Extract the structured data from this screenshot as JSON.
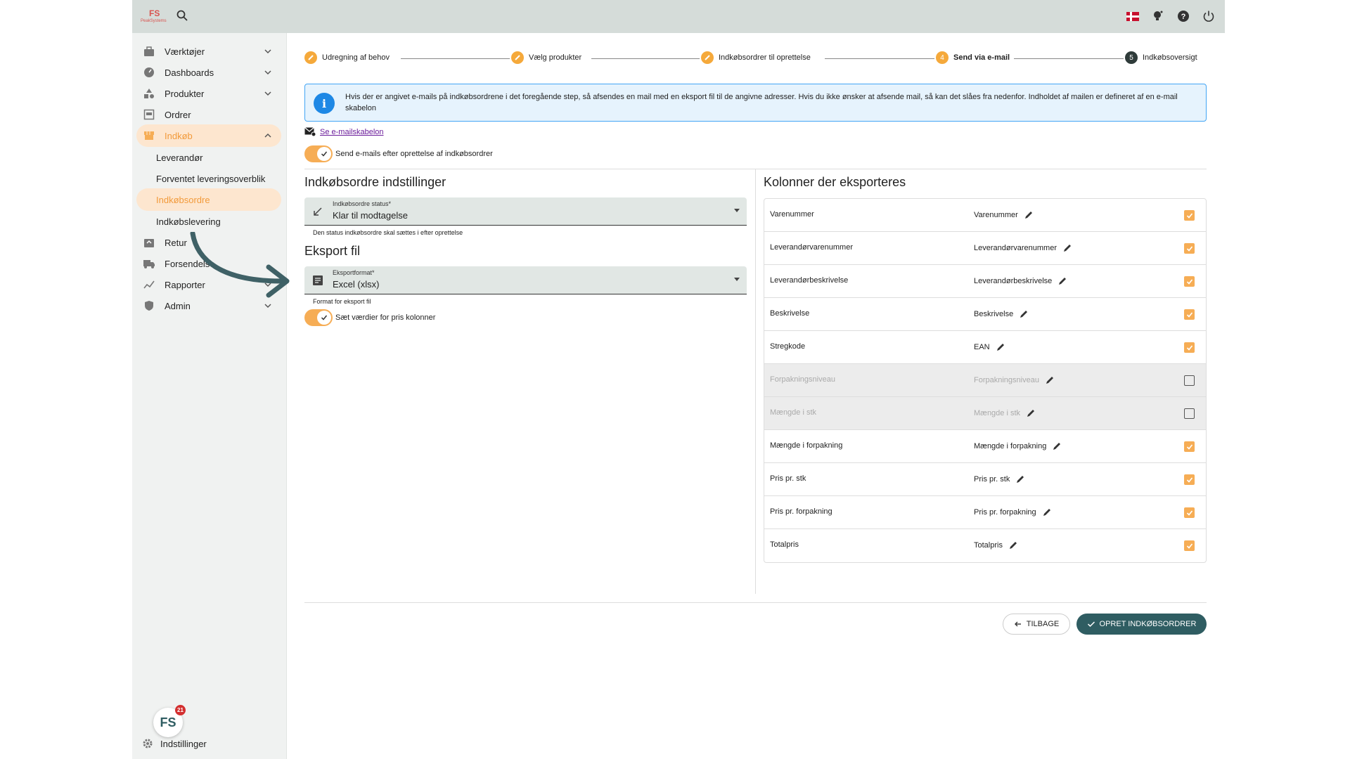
{
  "topbar": {
    "logo_mark": "FS",
    "logo_name": "PeakSystems",
    "icons": [
      "search-icon",
      "danish-flag-icon",
      "lightbulb-icon",
      "help-icon",
      "power-icon"
    ]
  },
  "sidebar": {
    "items": [
      {
        "label": "Værktøjer",
        "icon": "tools-icon",
        "expandable": true
      },
      {
        "label": "Dashboards",
        "icon": "dashboard-icon",
        "expandable": true
      },
      {
        "label": "Produkter",
        "icon": "products-icon",
        "expandable": true
      },
      {
        "label": "Ordrer",
        "icon": "orders-icon",
        "expandable": false
      },
      {
        "label": "Indkøb",
        "icon": "purchase-icon",
        "expandable": true,
        "expanded": true
      }
    ],
    "subitems": [
      {
        "label": "Leverandør"
      },
      {
        "label": "Forventet leveringsoverblik"
      },
      {
        "label": "Indkøbsordre"
      },
      {
        "label": "Indkøbslevering"
      }
    ],
    "items_after": [
      {
        "label": "Retur",
        "icon": "return-icon",
        "expandable": false
      },
      {
        "label": "Forsendelse",
        "icon": "shipping-icon",
        "expandable": false
      },
      {
        "label": "Rapporter",
        "icon": "reports-icon",
        "expandable": true
      },
      {
        "label": "Admin",
        "icon": "admin-icon",
        "expandable": true
      }
    ],
    "settings_label": "Indstillinger",
    "badge_logo": "FS",
    "badge_count": "21"
  },
  "stepper": {
    "steps": [
      {
        "label": "Udregning af behov",
        "state": "done"
      },
      {
        "label": "Vælg produkter",
        "state": "done"
      },
      {
        "label": "Indkøbsordrer til oprettelse",
        "state": "done"
      },
      {
        "label": "Send via e-mail",
        "state": "active",
        "number": "4"
      },
      {
        "label": "Indkøbsoversigt",
        "state": "pending",
        "number": "5"
      }
    ]
  },
  "info": {
    "text": "Hvis der er angivet e-mails på indkøbsordrene i det foregående step, så afsendes en mail med en eksport fil til de angivne adresser. Hvis du ikke ønsker at afsende mail, så kan det slåes fra nedenfor. Indholdet af mailen er defineret af en e-mail skabelon"
  },
  "email": {
    "template_link": "Se e-mailskabelon",
    "send_toggle_label": "Send e-mails efter oprettelse af indkøbsordrer",
    "send_toggle_on": true
  },
  "settings": {
    "title": "Indkøbsordre indstillinger",
    "status_label": "Indkøbsordre status*",
    "status_value": "Klar til modtagelse",
    "status_helper": "Den status indkøbsordre skal sættes i efter oprettelse",
    "export_title": "Eksport fil",
    "format_label": "Eksportformat*",
    "format_value": "Excel (xlsx)",
    "format_helper": "Format for eksport fil",
    "price_toggle_label": "Sæt værdier for pris kolonner",
    "price_toggle_on": true
  },
  "columns": {
    "title": "Kolonner der eksporteres",
    "rows": [
      {
        "name": "Varenummer",
        "alias": "Varenummer",
        "checked": true
      },
      {
        "name": "Leverandørvarenummer",
        "alias": "Leverandørvarenummer",
        "checked": true
      },
      {
        "name": "Leverandørbeskrivelse",
        "alias": "Leverandørbeskrivelse",
        "checked": true
      },
      {
        "name": "Beskrivelse",
        "alias": "Beskrivelse",
        "checked": true
      },
      {
        "name": "Stregkode",
        "alias": "EAN",
        "checked": true
      },
      {
        "name": "Forpakningsniveau",
        "alias": "Forpakningsniveau",
        "checked": false
      },
      {
        "name": "Mængde i stk",
        "alias": "Mængde i stk",
        "checked": false
      },
      {
        "name": "Mængde i forpakning",
        "alias": "Mængde i forpakning",
        "checked": true
      },
      {
        "name": "Pris pr. stk",
        "alias": "Pris pr. stk",
        "checked": true
      },
      {
        "name": "Pris pr. forpakning",
        "alias": "Pris pr. forpakning",
        "checked": true
      },
      {
        "name": "Totalpris",
        "alias": "Totalpris",
        "checked": true
      }
    ]
  },
  "actions": {
    "back_label": "TILBAGE",
    "create_label": "OPRET INDKØBSORDRER"
  },
  "colors": {
    "accent": "#f6ad55",
    "primary": "#2f5d62",
    "topbar": "#d5dcd9",
    "info_border": "#42a5f5"
  }
}
